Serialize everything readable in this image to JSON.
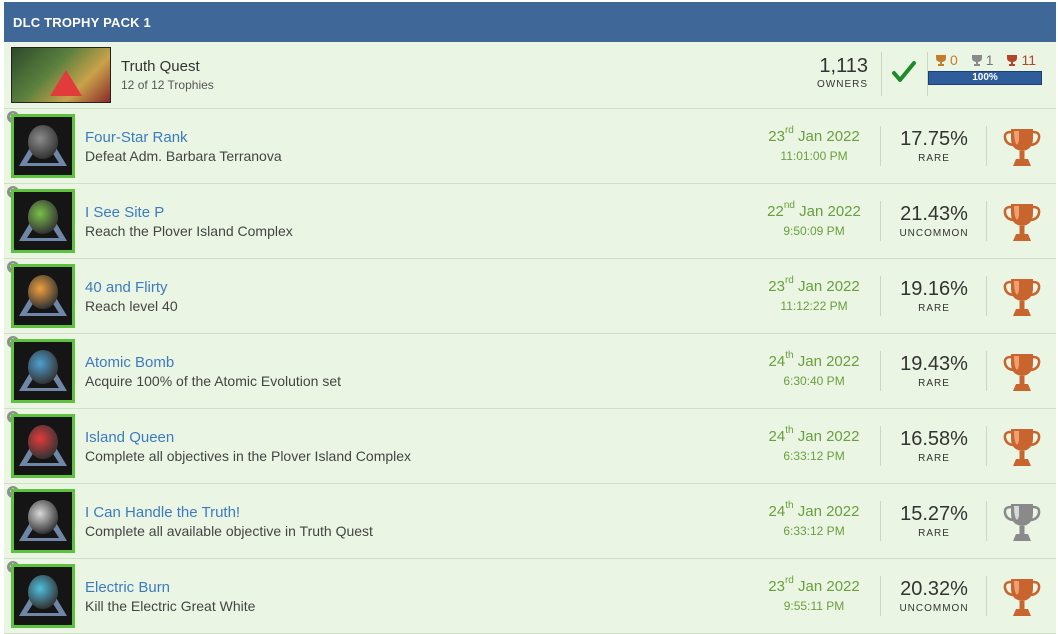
{
  "header": {
    "title": "DLC TROPHY PACK 1"
  },
  "game": {
    "title": "Truth Quest",
    "progress_earned": "12",
    "progress_of": "of",
    "progress_total": "12",
    "progress_suffix": "Trophies",
    "owners_count": "1,113",
    "owners_label": "OWNERS",
    "gold_count": "0",
    "silver_count": "1",
    "bronze_count": "11",
    "completion": "100%",
    "completion_fraction": 1.0
  },
  "colors": {
    "header_bg": "#3f6797",
    "row_bg": "#eaf6e3",
    "link": "#3d7bc0",
    "date": "#6a9e3e",
    "icon_border": "#5fc23e",
    "gold": "#c47c2c",
    "silver": "#8a8a8a",
    "bronze": "#b2452a"
  },
  "trophies": [
    {
      "name": "Four-Star Rank",
      "desc": "Defeat Adm. Barbara Terranova",
      "day": "23",
      "suffix": "rd",
      "monthyear": "Jan 2022",
      "time": "11:01:00 PM",
      "percent": "17.75%",
      "rarity": "RARE",
      "type": "bronze",
      "icon": "officer-icon"
    },
    {
      "name": "I See Site P",
      "desc": "Reach the Plover Island Complex",
      "day": "22",
      "suffix": "nd",
      "monthyear": "Jan 2022",
      "time": "9:50:09 PM",
      "percent": "21.43%",
      "rarity": "UNCOMMON",
      "type": "bronze",
      "icon": "radar-icon"
    },
    {
      "name": "40 and Flirty",
      "desc": "Reach level 40",
      "day": "23",
      "suffix": "rd",
      "monthyear": "Jan 2022",
      "time": "11:12:22 PM",
      "percent": "19.16%",
      "rarity": "RARE",
      "type": "bronze",
      "icon": "level-40-icon"
    },
    {
      "name": "Atomic Bomb",
      "desc": "Acquire 100% of the Atomic Evolution set",
      "day": "24",
      "suffix": "th",
      "monthyear": "Jan 2022",
      "time": "6:30:40 PM",
      "percent": "19.43%",
      "rarity": "RARE",
      "type": "bronze",
      "icon": "atomic-creature-icon"
    },
    {
      "name": "Island Queen",
      "desc": "Complete all objectives in the Plover Island Complex",
      "day": "24",
      "suffix": "th",
      "monthyear": "Jan 2022",
      "time": "6:33:12 PM",
      "percent": "16.58%",
      "rarity": "RARE",
      "type": "bronze",
      "icon": "red-triangle-icon"
    },
    {
      "name": "I Can Handle the Truth!",
      "desc": "Complete all available objective in Truth Quest",
      "day": "24",
      "suffix": "th",
      "monthyear": "Jan 2022",
      "time": "6:33:12 PM",
      "percent": "15.27%",
      "rarity": "RARE",
      "type": "silver",
      "icon": "aperture-icon"
    },
    {
      "name": "Electric Burn",
      "desc": "Kill the Electric Great White",
      "day": "23",
      "suffix": "rd",
      "monthyear": "Jan 2022",
      "time": "9:55:11 PM",
      "percent": "20.32%",
      "rarity": "UNCOMMON",
      "type": "bronze",
      "icon": "electric-shark-icon"
    }
  ]
}
